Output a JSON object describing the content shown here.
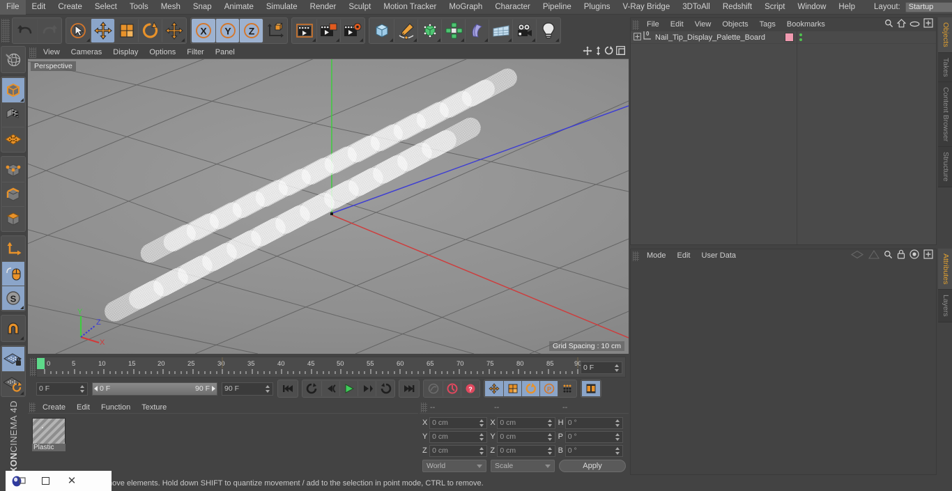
{
  "app": {
    "brand_top": "MAXON",
    "brand_bottom": "CINEMA 4D"
  },
  "menubar": {
    "items": [
      "File",
      "Edit",
      "Create",
      "Select",
      "Tools",
      "Mesh",
      "Snap",
      "Animate",
      "Simulate",
      "Render",
      "Sculpt",
      "Motion Tracker",
      "MoGraph",
      "Character",
      "Pipeline",
      "Plugins",
      "V-Ray Bridge",
      "3DToAll",
      "Redshift",
      "Script",
      "Window",
      "Help"
    ],
    "layout_label": "Layout:",
    "layout_value": "Startup",
    "search_icon": "search-icon"
  },
  "toolbar": {
    "undo": "undo-icon",
    "redo": "redo-icon",
    "live_selection": "live-selection-icon",
    "move": "move-tool-icon",
    "scale": "scale-tool-icon",
    "rotate": "rotate-tool-icon",
    "move_alt": "move-alt-icon",
    "axis_x": "X",
    "axis_y": "Y",
    "axis_z": "Z",
    "world_axis": "world-coordinate-icon",
    "render_view": "render-view-icon",
    "render_region": "render-region-icon",
    "render_settings": "render-settings-icon",
    "cube": "primitive-cube-icon",
    "spline": "spline-pen-icon",
    "nurbs": "generator-icon",
    "array": "mograph-cloner-icon",
    "deformer": "bend-deformer-icon",
    "scene": "scene-environment-icon",
    "camera": "camera-icon",
    "light": "light-icon"
  },
  "left_toolbar": {
    "items": [
      {
        "name": "make-editable-icon",
        "active": false
      },
      {
        "name": "model-mode-icon",
        "active": true
      },
      {
        "name": "texture-mode-icon",
        "active": false
      },
      {
        "name": "uv-mesh-icon",
        "active": false
      },
      {
        "name": "points-mode-icon",
        "active": false
      },
      {
        "name": "edges-mode-icon",
        "active": false
      },
      {
        "name": "polygons-mode-icon",
        "active": false
      },
      {
        "name": "object-axis-icon",
        "active": false
      },
      {
        "name": "viewport-solo-icon",
        "active": true
      },
      {
        "name": "snap-enable-icon",
        "active": true
      },
      {
        "name": "magnet-icon",
        "active": false
      },
      {
        "name": "workplane-lock-icon",
        "active": true
      },
      {
        "name": "workplane-rotate-icon",
        "active": false
      }
    ]
  },
  "viewport": {
    "menu": [
      "View",
      "Cameras",
      "Display",
      "Options",
      "Filter",
      "Panel"
    ],
    "label": "Perspective",
    "grid_info": "Grid Spacing : 10 cm",
    "axis_labels": {
      "x": "X",
      "y": "Y",
      "z": "Z"
    },
    "nav_icons": [
      "pan-icon",
      "zoom-icon",
      "orbit-icon",
      "maximize-viewport-icon"
    ]
  },
  "timeline": {
    "ticks": [
      0,
      5,
      10,
      15,
      20,
      25,
      30,
      35,
      40,
      45,
      50,
      55,
      60,
      65,
      70,
      75,
      80,
      85,
      90
    ],
    "current_frame": "0 F",
    "frame_field": "0 F",
    "range_start": "0 F",
    "range_end": "90 F",
    "end_field": "90 F",
    "transport": [
      "go-to-start-icon",
      "play-backwards-loop-icon",
      "step-back-icon",
      "play-icon",
      "step-forward-icon",
      "loop-icon",
      "go-to-end-icon"
    ],
    "record_group": [
      "autokey-icon",
      "record-keyframe-icon",
      "keyframe-selection-icon"
    ],
    "key_group": [
      "position-key-icon",
      "scale-key-icon",
      "rotation-key-icon",
      "parameter-key-icon",
      "point-level-key-icon",
      "timeline-icon"
    ]
  },
  "material_manager": {
    "menu": [
      "Create",
      "Edit",
      "Function",
      "Texture"
    ],
    "materials": [
      {
        "name": "Plastic"
      }
    ]
  },
  "coordinates": {
    "headers": [
      "--",
      "--",
      "--"
    ],
    "rows": [
      {
        "pos_label": "X",
        "pos_value": "0 cm",
        "size_label": "X",
        "size_value": "0 cm",
        "rot_label": "H",
        "rot_value": "0 °"
      },
      {
        "pos_label": "Y",
        "pos_value": "0 cm",
        "size_label": "Y",
        "size_value": "0 cm",
        "rot_label": "P",
        "rot_value": "0 °"
      },
      {
        "pos_label": "Z",
        "pos_value": "0 cm",
        "size_label": "Z",
        "size_value": "0 cm",
        "rot_label": "B",
        "rot_value": "0 °"
      }
    ],
    "system": "World",
    "mode": "Scale",
    "apply": "Apply"
  },
  "object_manager": {
    "menu": [
      "File",
      "Edit",
      "View",
      "Objects",
      "Tags",
      "Bookmarks"
    ],
    "icons": [
      "search-icon",
      "home-icon",
      "eye-icon",
      "add-layer-icon"
    ],
    "objects": [
      {
        "name": "Nail_Tip_Display_Palette_Board",
        "material_color": "#f09ab0",
        "tag_dots": 2,
        "level": "0"
      }
    ]
  },
  "attribute_manager": {
    "menu": [
      "Mode",
      "Edit",
      "User Data"
    ],
    "icons": [
      "history-back-icon",
      "history-forward-icon",
      "search-icon",
      "lock-icon",
      "target-icon",
      "add-icon"
    ]
  },
  "right_tabs_top": [
    {
      "label": "Objects",
      "selected": true
    },
    {
      "label": "Takes",
      "selected": false
    },
    {
      "label": "Content Browser",
      "selected": false
    },
    {
      "label": "Structure",
      "selected": false
    }
  ],
  "right_tabs_bottom": [
    {
      "label": "Attributes",
      "selected": true
    },
    {
      "label": "Layers",
      "selected": false
    }
  ],
  "statusbar": {
    "text": "move elements. Hold down SHIFT to quantize movement / add to the selection in point mode, CTRL to remove."
  },
  "taskbar": {
    "app_icon": "c4d-app-icon",
    "restore_icon": "restore-window-icon",
    "maximize_icon": "maximize-window-icon",
    "close_icon": "close-window-icon"
  },
  "colors": {
    "panel_bg": "#434343",
    "accent_blue": "#8ba5c9",
    "accent_orange": "#e0a030",
    "axis_x": "#cc3333",
    "axis_y": "#33bb33",
    "axis_z": "#3344cc",
    "material_pink": "#f09ab0"
  }
}
